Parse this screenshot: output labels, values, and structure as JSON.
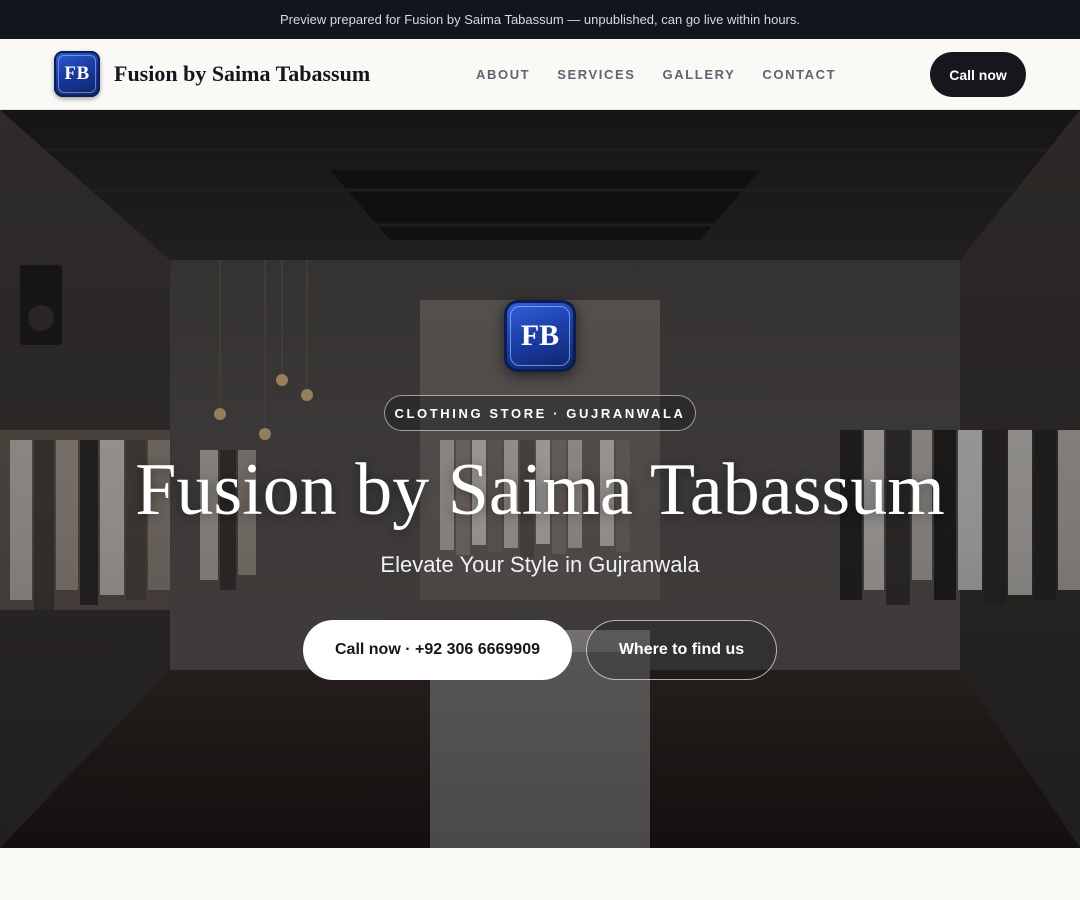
{
  "preview_banner": {
    "text": "Preview prepared for Fusion by Saima Tabassum — unpublished, can go live within hours."
  },
  "header": {
    "logo_text": "FB",
    "brand_name": "Fusion by Saima Tabassum",
    "nav": [
      {
        "label": "ABOUT"
      },
      {
        "label": "SERVICES"
      },
      {
        "label": "GALLERY"
      },
      {
        "label": "CONTACT"
      }
    ],
    "cta_label": "Call now"
  },
  "hero": {
    "logo_text": "FB",
    "tagline_pill": "CLOTHING STORE · GUJRANWALA",
    "title": "Fusion by Saima Tabassum",
    "subtitle": "Elevate Your Style in Gujranwala",
    "primary_button": "Call now · +92 306 6669909",
    "secondary_button": "Where to find us",
    "background_image": "clothing-store-interior-photo"
  },
  "colors": {
    "banner_bg": "#12151b",
    "header_bg": "#faf9f6",
    "cta_bg": "#15171d",
    "logo_blue": "#1c40ad",
    "nav_text": "#5e6470"
  }
}
